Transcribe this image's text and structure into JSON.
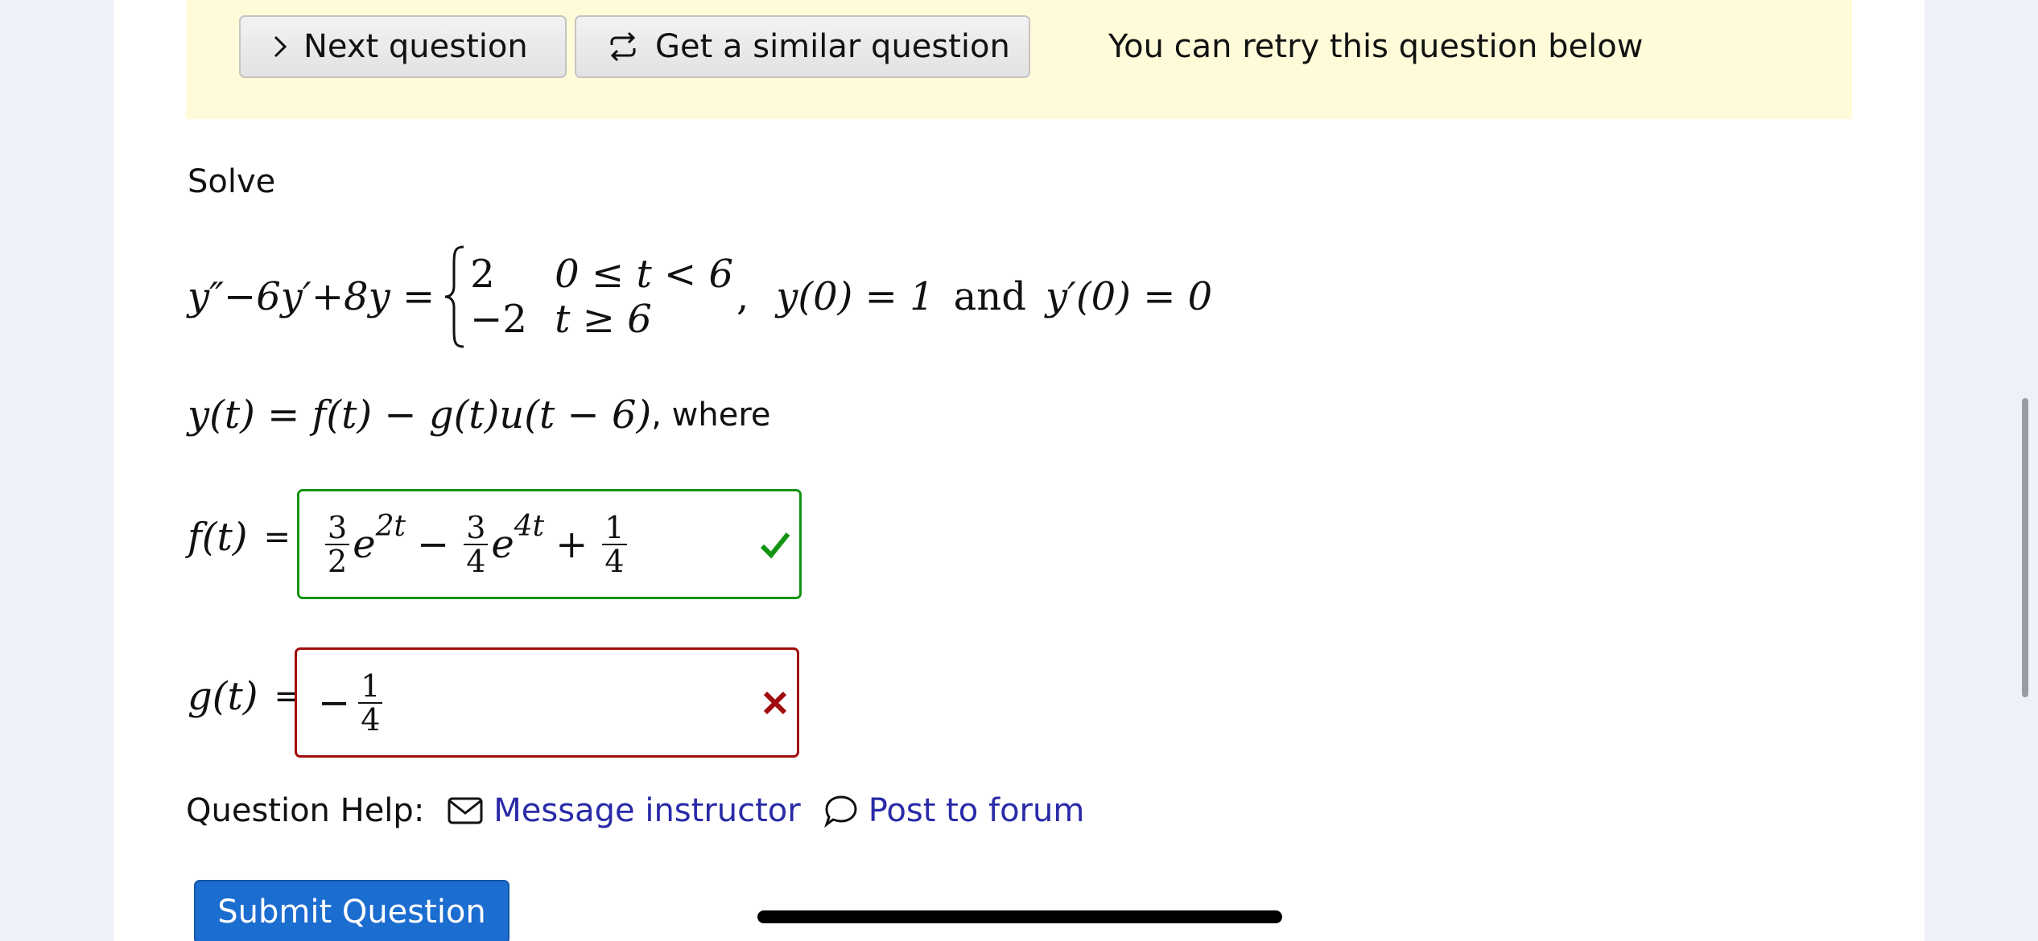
{
  "banner": {
    "next_label": "Next question",
    "similar_label": "Get a similar question",
    "retry_text": "You can retry this question below"
  },
  "question": {
    "prompt": "Solve",
    "ode": "y″−6y′+8y =",
    "case1_value": "2",
    "case1_cond": "0 ≤ t < 6",
    "case2_value": "−2",
    "case2_cond": "t ≥ 6",
    "initial_conditions_a": "y(0) = 1",
    "and_word": "and",
    "initial_conditions_b": "y′(0) = 0",
    "solution_form": "y(t) = f(t) − g(t)u(t − 6)",
    "where_text": ", where"
  },
  "answers": {
    "f_label": "f(t)",
    "f_eq": "=",
    "f_term1_num": "3",
    "f_term1_den": "2",
    "f_term1_exp": "2t",
    "f_minus": "−",
    "f_term2_num": "3",
    "f_term2_den": "4",
    "f_term2_exp": "4t",
    "f_plus": "+",
    "f_term3_num": "1",
    "f_term3_den": "4",
    "f_status": "correct",
    "g_label": "g(t)",
    "g_eq": "=",
    "g_sign": "−",
    "g_num": "1",
    "g_den": "4",
    "g_status": "incorrect"
  },
  "help": {
    "label": "Question Help:",
    "message_label": "Message instructor",
    "forum_label": "Post to forum"
  },
  "submit_label": "Submit Question",
  "colors": {
    "banner_bg": "#fffbd9",
    "correct": "#139413",
    "incorrect": "#a10d0d",
    "link": "#2a2aa8",
    "submit_bg": "#1c6dd0"
  }
}
